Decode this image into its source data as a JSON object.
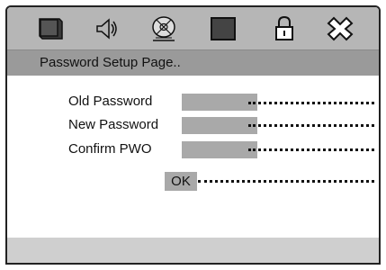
{
  "header": {
    "icons": [
      "tv-icon",
      "speaker-icon",
      "disc-icon",
      "square-icon",
      "lock-icon",
      "exit-icon"
    ]
  },
  "page": {
    "title": "Password Setup Page.."
  },
  "form": {
    "old_password_label": "Old Password",
    "new_password_label": "New Password",
    "confirm_label": "Confirm PWO",
    "ok_label": "OK"
  },
  "colors": {
    "icon_bar": "#b6b6b6",
    "title_bar": "#9a9a9a",
    "input_fill": "#a9a9a9",
    "footer_bar": "#cfcfcf"
  }
}
